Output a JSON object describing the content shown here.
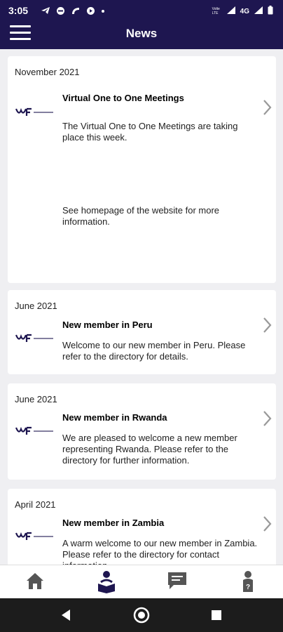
{
  "status": {
    "time": "3:05",
    "network": "4G",
    "carrier_badge": "Volte LTE"
  },
  "appbar": {
    "title": "News"
  },
  "news": [
    {
      "date": "November 2021",
      "title": "Virtual One to One Meetings",
      "body": "The Virtual One to One Meetings are taking place this week.",
      "extra": "See homepage of the website for more information."
    },
    {
      "date": "June 2021",
      "title": "New member in Peru",
      "body": "Welcome to our new member in Peru.  Please refer to the directory for details."
    },
    {
      "date": "June 2021",
      "title": "New member in Rwanda",
      "body": "We are pleased to welcome a new member representing Rwanda.  Please refer to the directory for further information."
    },
    {
      "date": "April 2021",
      "title": "New member in Zambia",
      "body": "A warm welcome to our new member in Zambia. Please refer to the directory for contact information."
    }
  ],
  "tabs": [
    {
      "icon": "home-icon",
      "active": false
    },
    {
      "icon": "reading-person-icon",
      "active": true
    },
    {
      "icon": "chat-bubble-icon",
      "active": false
    },
    {
      "icon": "help-person-icon",
      "active": false
    }
  ],
  "colors": {
    "brand": "#1e1650",
    "card": "#ffffff",
    "background": "#efeff2",
    "icon": "#555555",
    "logo": "#1e1650"
  }
}
